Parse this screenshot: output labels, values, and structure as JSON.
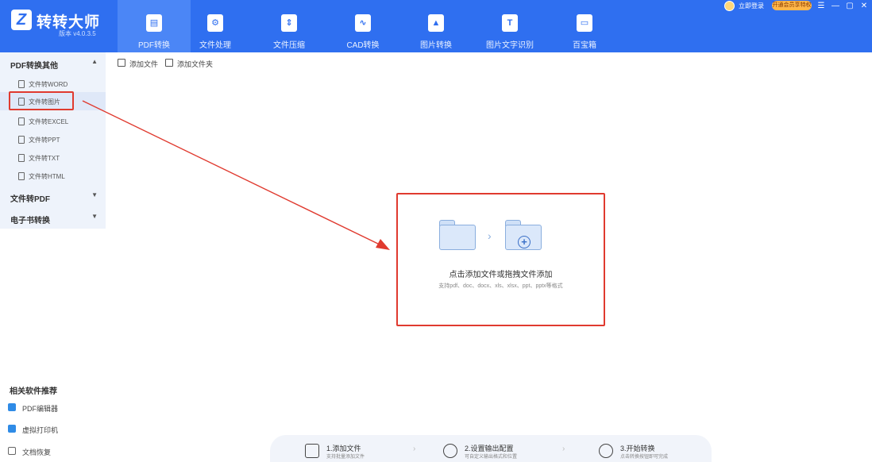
{
  "app": {
    "title": "转转大师",
    "version": "版本 v4.0.3.5",
    "logo_letter": "Z"
  },
  "header": {
    "tabs": [
      {
        "label": "PDF转换",
        "icon": "pdf-icon",
        "glyph": "▤",
        "active": true
      },
      {
        "label": "文件处理",
        "icon": "file-process-icon",
        "glyph": "⚙"
      },
      {
        "label": "文件压缩",
        "icon": "compress-icon",
        "glyph": "⇕"
      },
      {
        "label": "CAD转换",
        "icon": "cad-icon",
        "glyph": "∿"
      },
      {
        "label": "图片转换",
        "icon": "image-icon",
        "glyph": "▲"
      },
      {
        "label": "图片文字识别",
        "icon": "ocr-icon",
        "glyph": "T"
      },
      {
        "label": "百宝箱",
        "icon": "toolbox-icon",
        "glyph": "▭"
      }
    ],
    "login_text": "立即登录",
    "vip_text": "开通会员享特权",
    "window_controls": [
      "☰",
      "—",
      "▢",
      "✕"
    ]
  },
  "sidebar": {
    "groups": [
      {
        "label": "PDF转换其他",
        "caret": "▲",
        "expanded": true
      },
      {
        "label": "文件转PDF",
        "caret": "▼"
      },
      {
        "label": "电子书转换",
        "caret": "▼"
      }
    ],
    "items": [
      {
        "label": "文件转WORD"
      },
      {
        "label": "文件转图片",
        "active": true
      },
      {
        "label": "文件转EXCEL"
      },
      {
        "label": "文件转PPT"
      },
      {
        "label": "文件转TXT"
      },
      {
        "label": "文件转HTML"
      }
    ]
  },
  "related": {
    "title": "相关软件推荐",
    "items": [
      {
        "label": "PDF编辑器"
      },
      {
        "label": "虚拟打印机"
      },
      {
        "label": "文档恢复"
      }
    ]
  },
  "toolbar": {
    "add_file": "添加文件",
    "add_folder": "添加文件夹"
  },
  "dropzone": {
    "text": "点击添加文件或拖拽文件添加",
    "formats": "支持pdf、doc、docx、xls、xlsx、ppt、pptx等格式",
    "chevron": "›",
    "plus": "+"
  },
  "steps": [
    {
      "title": "1.添加文件",
      "sub": "支持批量添加文件"
    },
    {
      "title": "2.设置输出配置",
      "sub": "可自定义输出格式和位置"
    },
    {
      "title": "3.开始转换",
      "sub": "点击转换按钮即可完成"
    }
  ],
  "colors": {
    "header_bg": "#2f6ff0",
    "active_tab": "#4b86f6",
    "highlight": "#e03a2f",
    "sidebar_bg": "#eef3fb"
  }
}
